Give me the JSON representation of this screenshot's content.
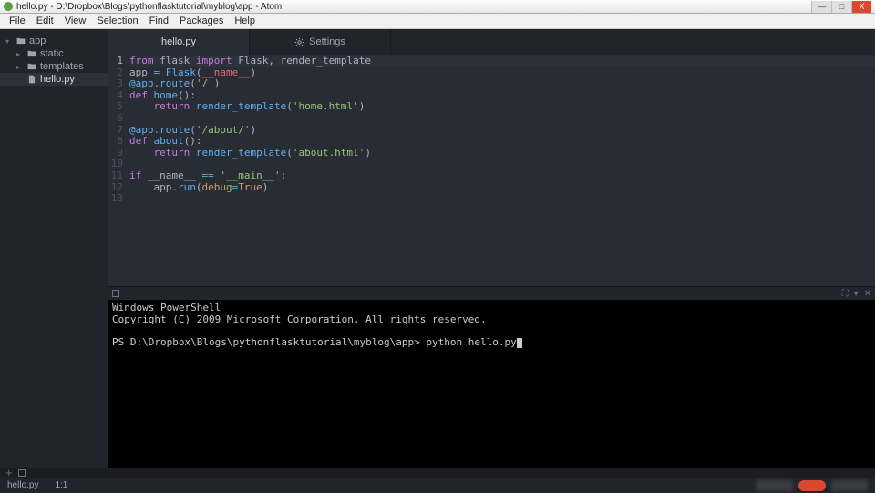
{
  "window": {
    "title": "hello.py - D:\\Dropbox\\Blogs\\pythonflasktutorial\\myblog\\app - Atom",
    "controls": {
      "min": "—",
      "max": "□",
      "close": "X"
    }
  },
  "menu": [
    "File",
    "Edit",
    "View",
    "Selection",
    "Find",
    "Packages",
    "Help"
  ],
  "tree": {
    "root": "app",
    "folders": [
      "static",
      "templates"
    ],
    "files": [
      "hello.py"
    ]
  },
  "tabs": [
    {
      "label": "hello.py",
      "active": true
    },
    {
      "label": "Settings",
      "active": false,
      "icon": "gear"
    }
  ],
  "code": {
    "active_line": 1,
    "lines": [
      {
        "n": 1,
        "tokens": [
          [
            "from ",
            "k-purple"
          ],
          [
            "flask ",
            ""
          ],
          [
            "import ",
            "k-purple"
          ],
          [
            "Flask",
            ""
          ],
          [
            ", ",
            ""
          ],
          [
            "render_template",
            ""
          ]
        ]
      },
      {
        "n": 2,
        "tokens": [
          [
            "app ",
            ""
          ],
          [
            "= ",
            "k-cyan"
          ],
          [
            "Flask",
            "k-blue"
          ],
          [
            "(",
            ""
          ],
          [
            "__name__",
            "k-red"
          ],
          [
            ")",
            ""
          ]
        ]
      },
      {
        "n": 3,
        "tokens": [
          [
            "@app.route",
            "k-blue"
          ],
          [
            "(",
            ""
          ],
          [
            "'/'",
            "k-green"
          ],
          [
            ")",
            ""
          ]
        ]
      },
      {
        "n": 4,
        "tokens": [
          [
            "def ",
            "k-purple"
          ],
          [
            "home",
            "k-blue"
          ],
          [
            "():",
            ""
          ]
        ]
      },
      {
        "n": 5,
        "tokens": [
          [
            "    ",
            ""
          ],
          [
            "return ",
            "k-purple"
          ],
          [
            "render_template",
            "k-blue"
          ],
          [
            "(",
            ""
          ],
          [
            "'home.html'",
            "k-green"
          ],
          [
            ")",
            ""
          ]
        ]
      },
      {
        "n": 6,
        "tokens": [
          [
            "",
            ""
          ]
        ]
      },
      {
        "n": 7,
        "tokens": [
          [
            "@app.route",
            "k-blue"
          ],
          [
            "(",
            ""
          ],
          [
            "'/about/'",
            "k-green"
          ],
          [
            ")",
            ""
          ]
        ]
      },
      {
        "n": 8,
        "tokens": [
          [
            "def ",
            "k-purple"
          ],
          [
            "about",
            "k-blue"
          ],
          [
            "():",
            ""
          ]
        ]
      },
      {
        "n": 9,
        "tokens": [
          [
            "    ",
            ""
          ],
          [
            "return ",
            "k-purple"
          ],
          [
            "render_template",
            "k-blue"
          ],
          [
            "(",
            ""
          ],
          [
            "'about.html'",
            "k-green"
          ],
          [
            ")",
            ""
          ]
        ]
      },
      {
        "n": 10,
        "tokens": [
          [
            "",
            ""
          ]
        ]
      },
      {
        "n": 11,
        "tokens": [
          [
            "if ",
            "k-purple"
          ],
          [
            "__name__ ",
            ""
          ],
          [
            "== ",
            "k-cyan"
          ],
          [
            "'__main__'",
            "k-green"
          ],
          [
            ":",
            ""
          ]
        ]
      },
      {
        "n": 12,
        "tokens": [
          [
            "    app.",
            ""
          ],
          [
            "run",
            "k-blue"
          ],
          [
            "(",
            ""
          ],
          [
            "debug",
            "k-orange"
          ],
          [
            "=",
            "k-cyan"
          ],
          [
            "True",
            "k-orange"
          ],
          [
            ")",
            ""
          ]
        ]
      },
      {
        "n": 13,
        "tokens": [
          [
            "",
            ""
          ]
        ]
      }
    ]
  },
  "terminal": {
    "header": "Windows PowerShell",
    "copyright": "Copyright (C) 2009 Microsoft Corporation. All rights reserved.",
    "prompt": "PS D:\\Dropbox\\Blogs\\pythonflasktutorial\\myblog\\app>",
    "command": "python hello.py"
  },
  "status": {
    "file": "hello.py",
    "pos": "1:1"
  }
}
